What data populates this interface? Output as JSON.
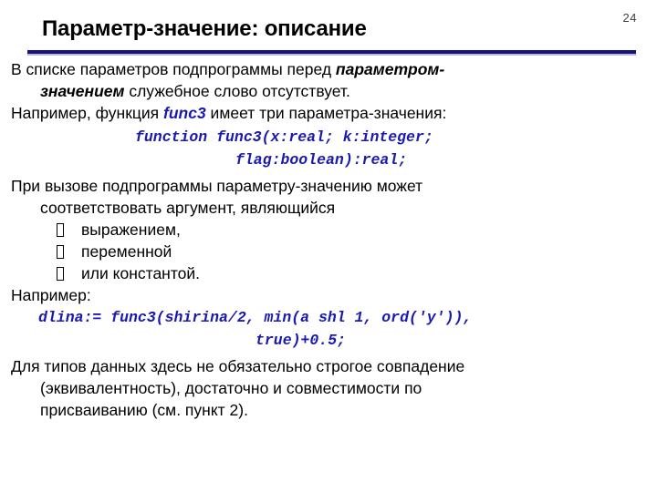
{
  "slide": {
    "number": "24",
    "title": "Параметр-значение: описание",
    "accent_color": "#14147a",
    "code_color": "#1a1ab0",
    "background_color": "#ffffff",
    "text_color": "#000000"
  },
  "body": {
    "para1": {
      "line1_a": "В списке параметров подпрограммы перед ",
      "line1_b": "параметром-",
      "line2_a": "значением",
      "line2_b": " служебное слово отсутствует."
    },
    "para2": {
      "a": "Например, функция ",
      "b": "func3",
      "c": " имеет три параметра-значения:"
    },
    "code1": {
      "line1": "function func3(x:real; k:integer;",
      "line2": "flag:boolean):real;"
    },
    "para3": {
      "line1": "При вызове подпрограммы параметру-значению может",
      "line2": "соответствовать аргумент, являющийся"
    },
    "bullets": [
      {
        "bullet_glyph": "missing-glyph-box",
        "label": "выражением,"
      },
      {
        "bullet_glyph": "missing-glyph-box",
        "label": "переменной"
      },
      {
        "bullet_glyph": "missing-glyph-box",
        "label": "или константой."
      }
    ],
    "para4": "Например:",
    "code2": {
      "line1": "dlina:= func3(shirina/2, min(a shl 1, ord('y')),",
      "line2": "true)+0.5;"
    },
    "para5": {
      "line1": "Для типов данных здесь не обязательно строгое совпадение",
      "line2": "(эквивалентность), достаточно и совместимости по",
      "line3": "присваиванию (см. пункт 2)."
    }
  }
}
